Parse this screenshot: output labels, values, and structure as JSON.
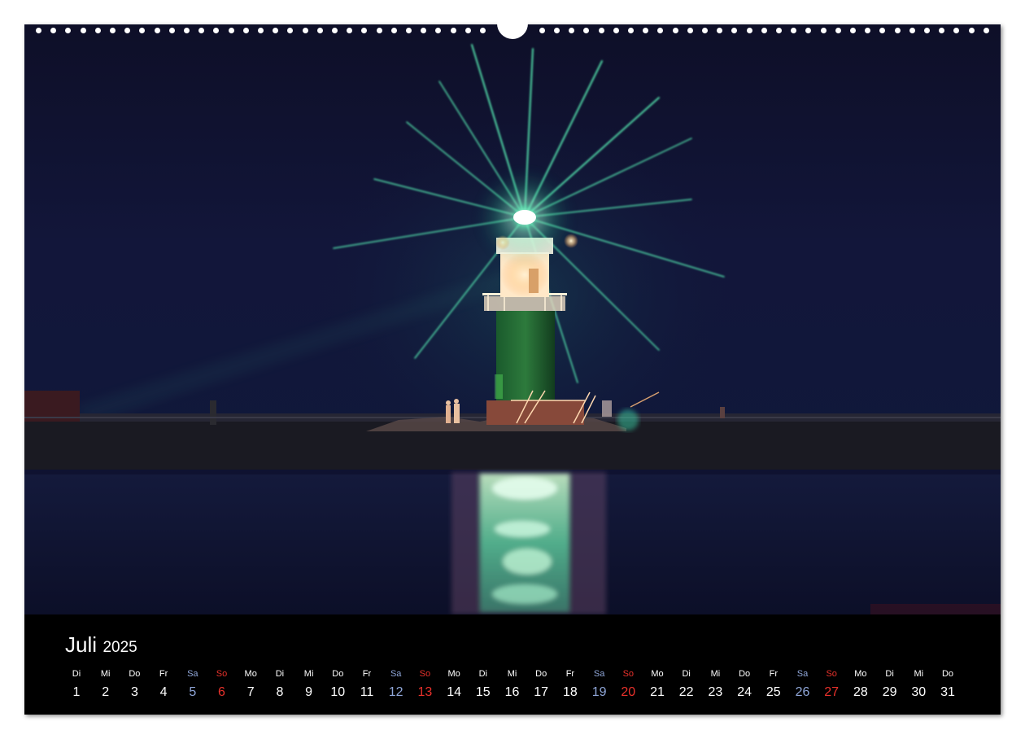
{
  "calendar": {
    "month": "Juli",
    "year": "2025",
    "days": [
      {
        "wd": "Di",
        "num": "1",
        "type": "weekday"
      },
      {
        "wd": "Mi",
        "num": "2",
        "type": "weekday"
      },
      {
        "wd": "Do",
        "num": "3",
        "type": "weekday"
      },
      {
        "wd": "Fr",
        "num": "4",
        "type": "weekday"
      },
      {
        "wd": "Sa",
        "num": "5",
        "type": "sat"
      },
      {
        "wd": "So",
        "num": "6",
        "type": "sun"
      },
      {
        "wd": "Mo",
        "num": "7",
        "type": "weekday"
      },
      {
        "wd": "Di",
        "num": "8",
        "type": "weekday"
      },
      {
        "wd": "Mi",
        "num": "9",
        "type": "weekday"
      },
      {
        "wd": "Do",
        "num": "10",
        "type": "weekday"
      },
      {
        "wd": "Fr",
        "num": "11",
        "type": "weekday"
      },
      {
        "wd": "Sa",
        "num": "12",
        "type": "sat"
      },
      {
        "wd": "So",
        "num": "13",
        "type": "sun"
      },
      {
        "wd": "Mo",
        "num": "14",
        "type": "weekday"
      },
      {
        "wd": "Di",
        "num": "15",
        "type": "weekday"
      },
      {
        "wd": "Mi",
        "num": "16",
        "type": "weekday"
      },
      {
        "wd": "Do",
        "num": "17",
        "type": "weekday"
      },
      {
        "wd": "Fr",
        "num": "18",
        "type": "weekday"
      },
      {
        "wd": "Sa",
        "num": "19",
        "type": "sat"
      },
      {
        "wd": "So",
        "num": "20",
        "type": "sun"
      },
      {
        "wd": "Mo",
        "num": "21",
        "type": "weekday"
      },
      {
        "wd": "Di",
        "num": "22",
        "type": "weekday"
      },
      {
        "wd": "Mi",
        "num": "23",
        "type": "weekday"
      },
      {
        "wd": "Do",
        "num": "24",
        "type": "weekday"
      },
      {
        "wd": "Fr",
        "num": "25",
        "type": "weekday"
      },
      {
        "wd": "Sa",
        "num": "26",
        "type": "sat"
      },
      {
        "wd": "So",
        "num": "27",
        "type": "sun"
      },
      {
        "wd": "Mo",
        "num": "28",
        "type": "weekday"
      },
      {
        "wd": "Di",
        "num": "29",
        "type": "weekday"
      },
      {
        "wd": "Mi",
        "num": "30",
        "type": "weekday"
      },
      {
        "wd": "Do",
        "num": "31",
        "type": "weekday"
      }
    ]
  },
  "colors": {
    "saturday": "#8fa6d8",
    "sunday": "#e8312b",
    "beacon": "#3dffb0"
  }
}
